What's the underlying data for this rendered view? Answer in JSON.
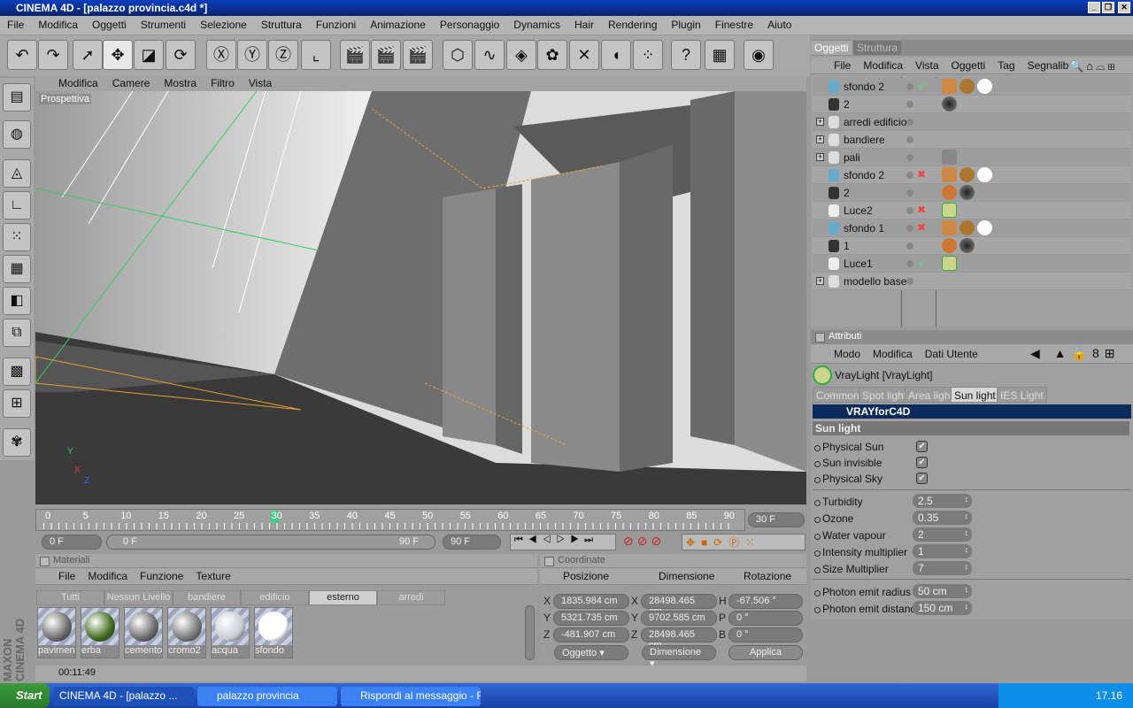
{
  "window": {
    "title": "CINEMA 4D - [palazzo provincia.c4d *]",
    "min": "_",
    "max": "❐",
    "close": "✕"
  },
  "menu": [
    "File",
    "Modifica",
    "Oggetti",
    "Strumenti",
    "Selezione",
    "Struttura",
    "Funzioni",
    "Animazione",
    "Personaggio",
    "Dynamics",
    "Hair",
    "Rendering",
    "Plugin",
    "Finestre",
    "Aiuto"
  ],
  "viewport": {
    "menu": [
      "Modifica",
      "Camere",
      "Mostra",
      "Filtro",
      "Vista"
    ],
    "label": "Prospettiva",
    "axis": {
      "x": "X",
      "y": "Y",
      "z": "Z"
    }
  },
  "timeline": {
    "ticks": [
      "0",
      "5",
      "10",
      "15",
      "20",
      "25",
      "30",
      "35",
      "40",
      "45",
      "50",
      "55",
      "60",
      "65",
      "70",
      "75",
      "80",
      "85",
      "90"
    ],
    "current_frame": 30,
    "current_field": "30 F",
    "start": "0 F",
    "range_start": "0 F",
    "range_end": "90 F",
    "end": "90 F"
  },
  "materials": {
    "title": "Materiali",
    "menu": [
      "File",
      "Modifica",
      "Funzione",
      "Texture"
    ],
    "tabs": [
      "Tutti",
      "Nessun Livello",
      "bandiere",
      "edificio",
      "esterno",
      "arredi"
    ],
    "selected_tab": "esterno",
    "items": [
      {
        "name": "pavimen",
        "color": "#6a6a6a"
      },
      {
        "name": "erba",
        "color": "#3f6a1a"
      },
      {
        "name": "cemento",
        "color": "#6a6a6a"
      },
      {
        "name": "cromo2",
        "color": "#777777"
      },
      {
        "name": "acqua",
        "color": "#c8ccd4"
      },
      {
        "name": "sfondo",
        "color": "#ffffff"
      }
    ]
  },
  "coordinates": {
    "title": "Coordinate",
    "headers": [
      "Posizione",
      "Dimensione",
      "Rotazione"
    ],
    "rows": [
      {
        "pl": "X",
        "p": "1835.984 cm",
        "dl": "X",
        "d": "28498.465 cm",
        "rl": "H",
        "r": "-67.506 °"
      },
      {
        "pl": "Y",
        "p": "5321.735 cm",
        "dl": "Y",
        "d": "9702.585 cm",
        "rl": "P",
        "r": "0 °"
      },
      {
        "pl": "Z",
        "p": "-481.907 cm",
        "dl": "Z",
        "d": "28498.465 cm",
        "rl": "B",
        "r": "0 °"
      }
    ],
    "mode": "Oggetto",
    "size_mode": "Dimensione",
    "apply": "Applica"
  },
  "status": "00:11:49",
  "objects": {
    "tabs": [
      "Oggetti",
      "Struttura"
    ],
    "menu": [
      "File",
      "Modifica",
      "Vista",
      "Oggetti",
      "Tag",
      "Segnalib"
    ],
    "rows": [
      {
        "name": "sfondo 2",
        "type": "background",
        "expand": false,
        "status": "✔"
      },
      {
        "name": "2",
        "type": "camera",
        "expand": false,
        "status": ""
      },
      {
        "name": "arredi edificio",
        "type": "null",
        "expand": true,
        "status": ""
      },
      {
        "name": "bandiere",
        "type": "null",
        "expand": true,
        "status": ""
      },
      {
        "name": "pali",
        "type": "null",
        "expand": true,
        "status": ""
      },
      {
        "name": "sfondo 2",
        "type": "background",
        "expand": false,
        "status": "✖"
      },
      {
        "name": "2",
        "type": "camera",
        "expand": false,
        "status": ""
      },
      {
        "name": "Luce2",
        "type": "light",
        "expand": false,
        "status": "✖"
      },
      {
        "name": "sfondo 1",
        "type": "background",
        "expand": false,
        "status": "✖"
      },
      {
        "name": "1",
        "type": "camera",
        "expand": false,
        "status": ""
      },
      {
        "name": "Luce1",
        "type": "light",
        "expand": false,
        "status": "✔"
      },
      {
        "name": "modello base",
        "type": "null",
        "expand": true,
        "status": ""
      }
    ]
  },
  "attributes": {
    "title": "Attributi",
    "menu": [
      "Modo",
      "Modifica",
      "Dati Utente"
    ],
    "object": "VrayLight [VrayLight]",
    "tabs": [
      "Common",
      "Spot light",
      "Area light",
      "Sun light",
      "IES Light"
    ],
    "selected_tab": "Sun light",
    "banner": "VRAYforC4D",
    "section": "Sun light",
    "checks": [
      {
        "label": "Physical Sun",
        "checked": true
      },
      {
        "label": "Sun invisible",
        "checked": true
      },
      {
        "label": "Physical Sky",
        "checked": true
      }
    ],
    "fields": [
      {
        "label": "Turbidity",
        "value": "2.5"
      },
      {
        "label": "Ozone",
        "value": "0.35"
      },
      {
        "label": "Water vapour",
        "value": "2"
      },
      {
        "label": "Intensity multiplier",
        "value": "1"
      },
      {
        "label": "Size Multiplier",
        "value": "7"
      }
    ],
    "photon": [
      {
        "label": "Photon emit radius",
        "value": "50 cm"
      },
      {
        "label": "Photon emit distance",
        "value": "150 cm"
      }
    ]
  },
  "taskbar": {
    "start": "Start",
    "tasks": [
      "CINEMA 4D - [palazzo ...",
      "palazzo provincia",
      "Rispondi al messaggio - F..."
    ],
    "clock": "17.16"
  }
}
